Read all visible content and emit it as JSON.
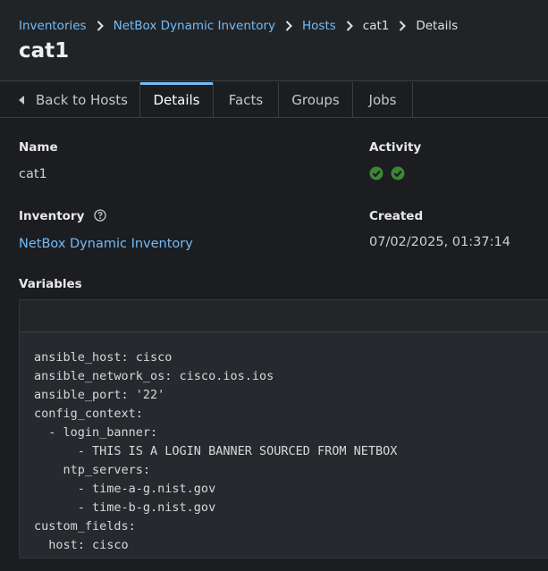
{
  "breadcrumb": {
    "items": [
      "Inventories",
      "NetBox Dynamic Inventory",
      "Hosts",
      "cat1",
      "Details"
    ]
  },
  "page": {
    "title": "cat1"
  },
  "tabs": {
    "back_label": "Back to Hosts",
    "items": [
      "Details",
      "Facts",
      "Groups",
      "Jobs"
    ],
    "active": "Details"
  },
  "details": {
    "name_label": "Name",
    "name_value": "cat1",
    "activity_label": "Activity",
    "activity_statuses": [
      "success",
      "success"
    ],
    "inventory_label": "Inventory",
    "inventory_value": "NetBox Dynamic Inventory",
    "created_label": "Created",
    "created_value": "07/02/2025, 01:37:14",
    "variables_label": "Variables"
  },
  "variables": {
    "lines": [
      "ansible_host: cisco",
      "ansible_network_os: cisco.ios.ios",
      "ansible_port: '22'",
      "config_context:",
      "  - login_banner:",
      "      - THIS IS A LOGIN BANNER SOURCED FROM NETBOX",
      "    ntp_servers:",
      "      - time-a-g.nist.gov",
      "      - time-b-g.nist.gov",
      "custom_fields:",
      "  host: cisco"
    ]
  },
  "colors": {
    "link": "#73bcf7",
    "success": "#3e8635",
    "background": "#1b1d21"
  }
}
